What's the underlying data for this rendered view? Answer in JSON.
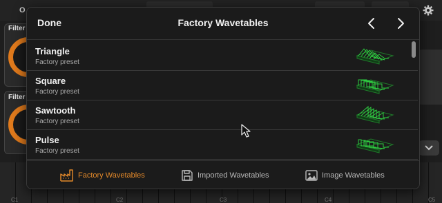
{
  "background": {
    "osc_label": "O",
    "filter_label": "Filter",
    "key_labels": [
      "C1",
      "C2",
      "C3",
      "C4",
      "C5"
    ],
    "icon": "gear-icon"
  },
  "modal": {
    "done_label": "Done",
    "title": "Factory Wavetables",
    "prev_icon": "chevron-left-icon",
    "next_icon": "chevron-right-icon"
  },
  "list": {
    "items": [
      {
        "name": "Triangle",
        "subtitle": "Factory preset"
      },
      {
        "name": "Square",
        "subtitle": "Factory preset"
      },
      {
        "name": "Sawtooth",
        "subtitle": "Factory preset"
      },
      {
        "name": "Pulse",
        "subtitle": "Factory preset"
      }
    ]
  },
  "tabs": [
    {
      "label": "Factory Wavetables",
      "icon": "factory-icon",
      "active": true
    },
    {
      "label": "Imported Wavetables",
      "icon": "save-disk-icon",
      "active": false
    },
    {
      "label": "Image Wavetables",
      "icon": "image-icon",
      "active": false
    }
  ],
  "colors": {
    "accent": "#e58a2a",
    "wave_green": "#2ecc40",
    "background": "#1b1b1b"
  }
}
